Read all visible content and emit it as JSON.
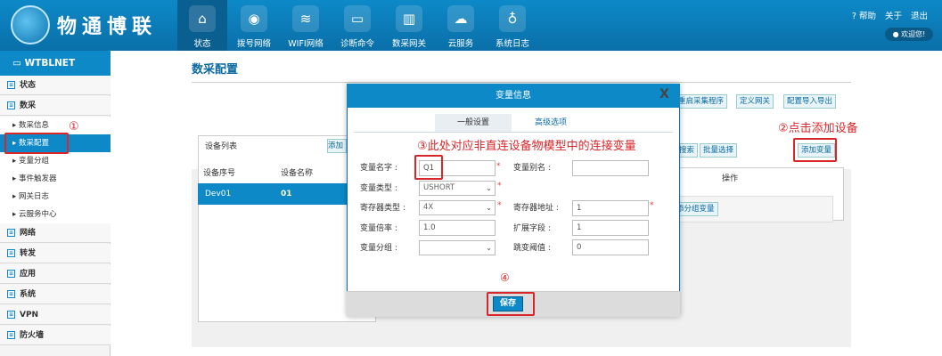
{
  "header": {
    "logo_text": "物通博联",
    "nav": [
      {
        "label": "状态",
        "icon": "home-icon"
      },
      {
        "label": "拨号网络",
        "icon": "broadcast-icon"
      },
      {
        "label": "WIFI网络",
        "icon": "wifi-icon"
      },
      {
        "label": "诊断命令",
        "icon": "terminal-icon"
      },
      {
        "label": "数采网关",
        "icon": "gateway-icon"
      },
      {
        "label": "云服务",
        "icon": "cloud-icon"
      },
      {
        "label": "系统日志",
        "icon": "stethoscope-icon"
      }
    ],
    "help": "? 帮助",
    "about": "关于",
    "logout": "退出",
    "welcome": "欢迎您!"
  },
  "sidebar": {
    "device": "WTBLNET",
    "items": [
      {
        "label": "状态"
      },
      {
        "label": "数采"
      },
      {
        "label": "网络"
      },
      {
        "label": "转发"
      },
      {
        "label": "应用"
      },
      {
        "label": "系统"
      },
      {
        "label": "VPN"
      },
      {
        "label": "防火墙"
      }
    ],
    "subitems": [
      {
        "label": "数采信息"
      },
      {
        "label": "数采配置"
      },
      {
        "label": "变量分组"
      },
      {
        "label": "事件触发器"
      },
      {
        "label": "网关日志"
      },
      {
        "label": "云服务中心"
      }
    ]
  },
  "page": {
    "title": "数采配置",
    "top_buttons": [
      "重启采集程序",
      "定义网关",
      "配置导入导出"
    ],
    "list_title": "设备列表",
    "list_add": "添加",
    "columns": [
      "设备序号",
      "设备名称"
    ],
    "rows": [
      {
        "id": "Dev01",
        "name": "01"
      }
    ],
    "right_buttons": [
      "搜索",
      "批量选择",
      "添加变量"
    ],
    "op_header": "操作",
    "group_var_btn": "添分组变量"
  },
  "modal": {
    "title": "变量信息",
    "close": "X",
    "tabs": [
      "一般设置",
      "高级选项"
    ],
    "fields": {
      "var_name_label": "变量名字 :",
      "var_name_value": "Q1",
      "var_alias_label": "变量别名 :",
      "var_alias_value": "",
      "var_type_label": "变量类型 :",
      "var_type_value": "USHORT",
      "reg_type_label": "寄存器类型 :",
      "reg_type_value": "4X",
      "reg_addr_label": "寄存器地址 :",
      "reg_addr_value": "1",
      "ratio_label": "变量倍率 :",
      "ratio_value": "1.0",
      "ext_label": "扩展字段 :",
      "ext_value": "1",
      "group_label": "变量分组 :",
      "group_value": "",
      "jump_label": "跳变阈值 :",
      "jump_value": "0"
    },
    "save": "保存"
  },
  "annotations": {
    "a1": "①",
    "a2": "②点击添加设备",
    "a3": "③此处对应非直连设备物模型中的连接变量",
    "a4": "④"
  },
  "colors": {
    "brand": "#0d89c8",
    "annotation": "#d9262a"
  }
}
